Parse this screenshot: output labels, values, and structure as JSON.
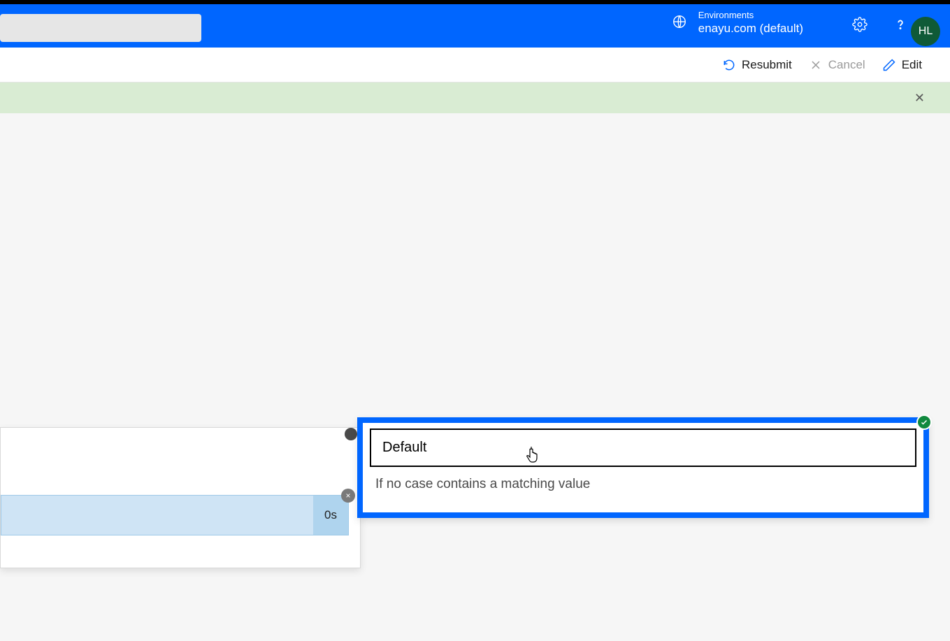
{
  "header": {
    "env_label": "Environments",
    "env_name": "enayu.com (default)",
    "avatar_initials": "HL"
  },
  "commandbar": {
    "resubmit": "Resubmit",
    "cancel": "Cancel",
    "edit": "Edit"
  },
  "left_card": {
    "duration": "0s",
    "nested_close": "×"
  },
  "default_card": {
    "title": "Default",
    "description": "If no case contains a matching value"
  }
}
